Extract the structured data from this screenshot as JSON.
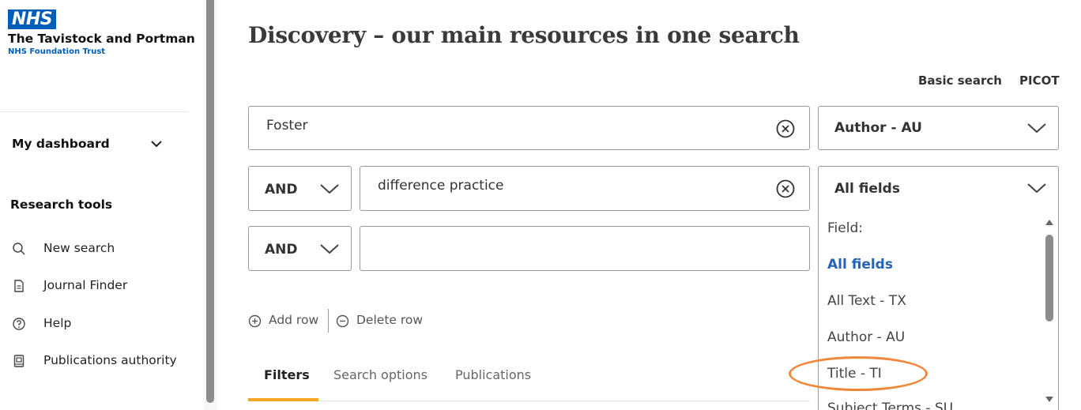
{
  "brand": {
    "logo_text": "NHS",
    "org_name": "The Tavistock and Portman",
    "org_sub": "NHS Foundation Trust",
    "color": "#005eb8"
  },
  "sidebar": {
    "dashboard_label": "My dashboard",
    "research_heading": "Research tools",
    "items": [
      {
        "label": "New search",
        "icon": "search-icon"
      },
      {
        "label": "Journal Finder",
        "icon": "document-icon"
      },
      {
        "label": "Help",
        "icon": "help-icon"
      },
      {
        "label": "Publications authority",
        "icon": "book-icon"
      }
    ]
  },
  "main": {
    "title": "Discovery – our main resources in one search",
    "links": {
      "basic_search": "Basic search",
      "picot": "PICOT"
    },
    "rows": [
      {
        "operator": "",
        "query": "Foster",
        "field": "Author - AU"
      },
      {
        "operator": "AND",
        "query": "difference practice",
        "field": "All fields"
      },
      {
        "operator": "AND",
        "query": "",
        "field": ""
      }
    ],
    "add_row": "Add row",
    "delete_row": "Delete row",
    "tabs": [
      {
        "label": "Filters",
        "active": true
      },
      {
        "label": "Search options",
        "active": false
      },
      {
        "label": "Publications",
        "active": false
      }
    ]
  },
  "dropdown": {
    "header": "Field:",
    "options": [
      "All fields",
      "All Text - TX",
      "Author - AU",
      "Title - TI",
      "Subject Terms - SU"
    ],
    "selected": "All fields",
    "highlighted": "Title - TI"
  },
  "colors": {
    "accent_tab": "#f5a623",
    "selected_option": "#2563b8",
    "highlight_ellipse": "#f0883a"
  }
}
